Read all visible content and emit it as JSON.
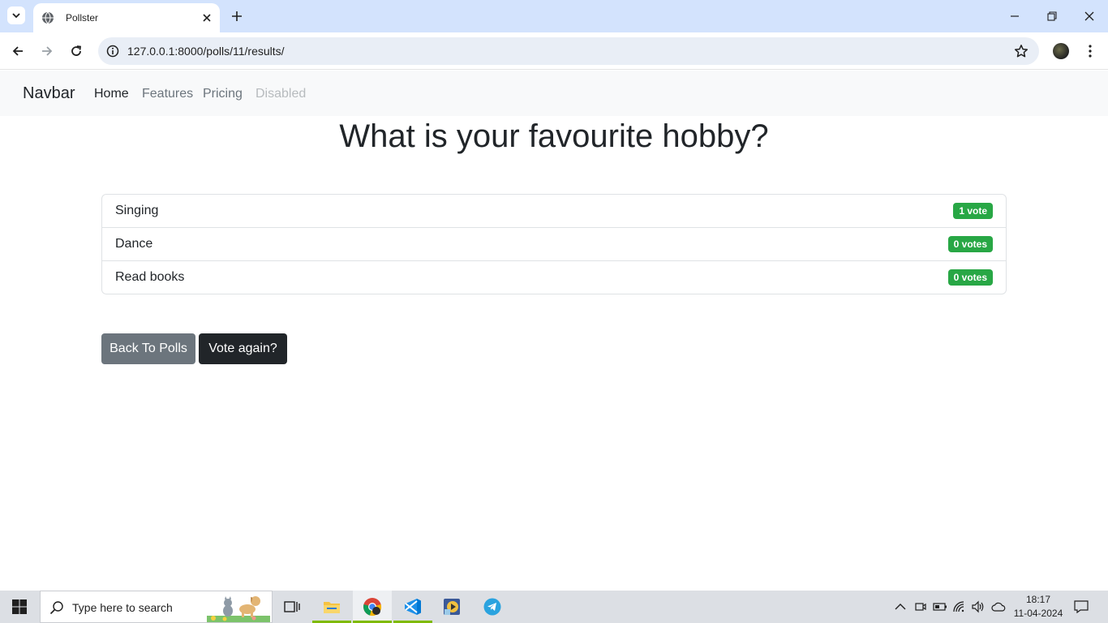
{
  "browser": {
    "tab_title": "Pollster",
    "url": "127.0.0.1:8000/polls/11/results/"
  },
  "navbar": {
    "brand": "Navbar",
    "links": [
      {
        "label": "Home",
        "state": "active"
      },
      {
        "label": "Features",
        "state": "normal"
      },
      {
        "label": "Pricing",
        "state": "normal"
      },
      {
        "label": "Disabled",
        "state": "disabled"
      }
    ]
  },
  "poll": {
    "question": "What is your favourite hobby?",
    "results": [
      {
        "choice": "Singing",
        "votes": "1 vote"
      },
      {
        "choice": "Dance",
        "votes": "0 votes"
      },
      {
        "choice": "Read books",
        "votes": "0 votes"
      }
    ],
    "back_button": "Back To Polls",
    "vote_again_button": "Vote again?"
  },
  "taskbar": {
    "search_placeholder": "Type here to search",
    "time": "18:17",
    "date": "11-04-2024"
  },
  "colors": {
    "badge_success": "#28a745",
    "btn_secondary": "#6c757d",
    "btn_dark": "#212529",
    "tabstrip": "#d3e3fd"
  },
  "icons": [
    "globe-icon",
    "close-icon",
    "plus-icon",
    "back-arrow-icon",
    "forward-arrow-icon",
    "reload-icon",
    "site-info-icon",
    "star-icon",
    "kebab-icon",
    "windows-icon",
    "search-icon",
    "task-view-icon",
    "file-explorer-icon",
    "chrome-icon",
    "vscode-icon",
    "media-icon",
    "telegram-icon",
    "chevron-up-icon",
    "battery-icon",
    "wifi-icon",
    "volume-icon",
    "cloud-icon",
    "notification-icon"
  ]
}
